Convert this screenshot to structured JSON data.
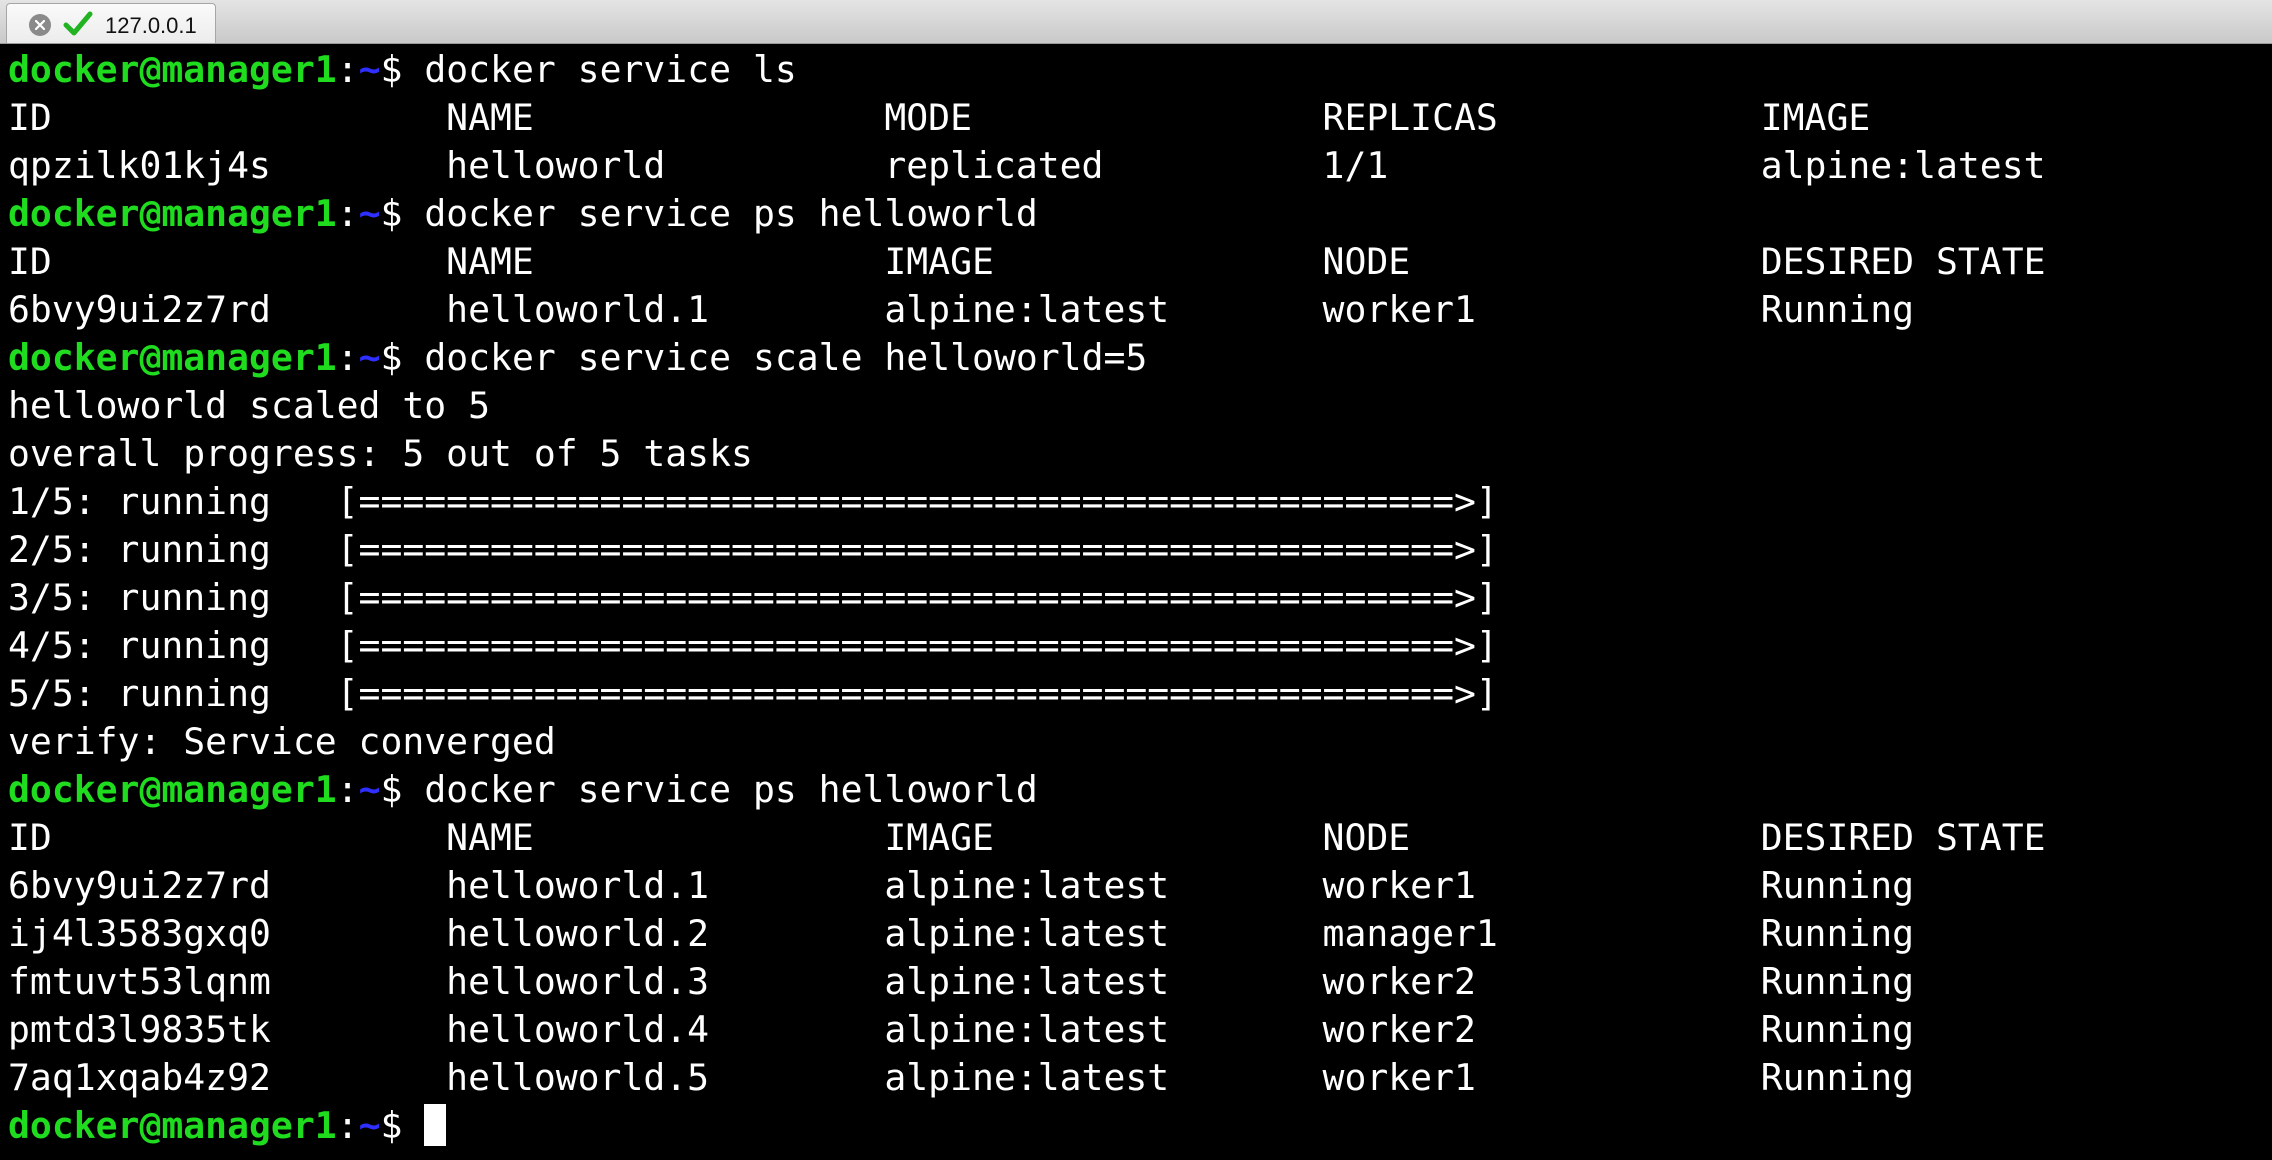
{
  "tab": {
    "title": "127.0.0.1"
  },
  "prompt": {
    "user_host": "docker@manager1",
    "path_prefix": ":",
    "path": "~",
    "symbol": "$ "
  },
  "lines": [
    {
      "type": "prompt",
      "command": "docker service ls"
    },
    {
      "type": "text",
      "text": "ID                  NAME                MODE                REPLICAS            IMAGE"
    },
    {
      "type": "text",
      "text": "qpzilk01kj4s        helloworld          replicated          1/1                 alpine:latest"
    },
    {
      "type": "prompt",
      "command": "docker service ps helloworld"
    },
    {
      "type": "text",
      "text": "ID                  NAME                IMAGE               NODE                DESIRED STATE"
    },
    {
      "type": "text",
      "text": "6bvy9ui2z7rd        helloworld.1        alpine:latest       worker1             Running"
    },
    {
      "type": "prompt",
      "command": "docker service scale helloworld=5"
    },
    {
      "type": "text",
      "text": "helloworld scaled to 5"
    },
    {
      "type": "text",
      "text": "overall progress: 5 out of 5 tasks"
    },
    {
      "type": "text",
      "text": "1/5: running   [==================================================>]"
    },
    {
      "type": "text",
      "text": "2/5: running   [==================================================>]"
    },
    {
      "type": "text",
      "text": "3/5: running   [==================================================>]"
    },
    {
      "type": "text",
      "text": "4/5: running   [==================================================>]"
    },
    {
      "type": "text",
      "text": "5/5: running   [==================================================>]"
    },
    {
      "type": "text",
      "text": "verify: Service converged"
    },
    {
      "type": "prompt",
      "command": "docker service ps helloworld"
    },
    {
      "type": "text",
      "text": "ID                  NAME                IMAGE               NODE                DESIRED STATE"
    },
    {
      "type": "text",
      "text": "6bvy9ui2z7rd        helloworld.1        alpine:latest       worker1             Running"
    },
    {
      "type": "text",
      "text": "ij4l3583gxq0        helloworld.2        alpine:latest       manager1            Running"
    },
    {
      "type": "text",
      "text": "fmtuvt53lqnm        helloworld.3        alpine:latest       worker2             Running"
    },
    {
      "type": "text",
      "text": "pmtd3l9835tk        helloworld.4        alpine:latest       worker2             Running"
    },
    {
      "type": "text",
      "text": "7aq1xqab4z92        helloworld.5        alpine:latest       worker1             Running"
    },
    {
      "type": "prompt",
      "command": "",
      "cursor": true
    }
  ],
  "colors": {
    "background": "#000000",
    "text": "#ffffff",
    "user": "#1fdc1f",
    "path": "#2f2fff"
  },
  "icons": {
    "close": "close-icon",
    "status": "checkmark-icon"
  }
}
